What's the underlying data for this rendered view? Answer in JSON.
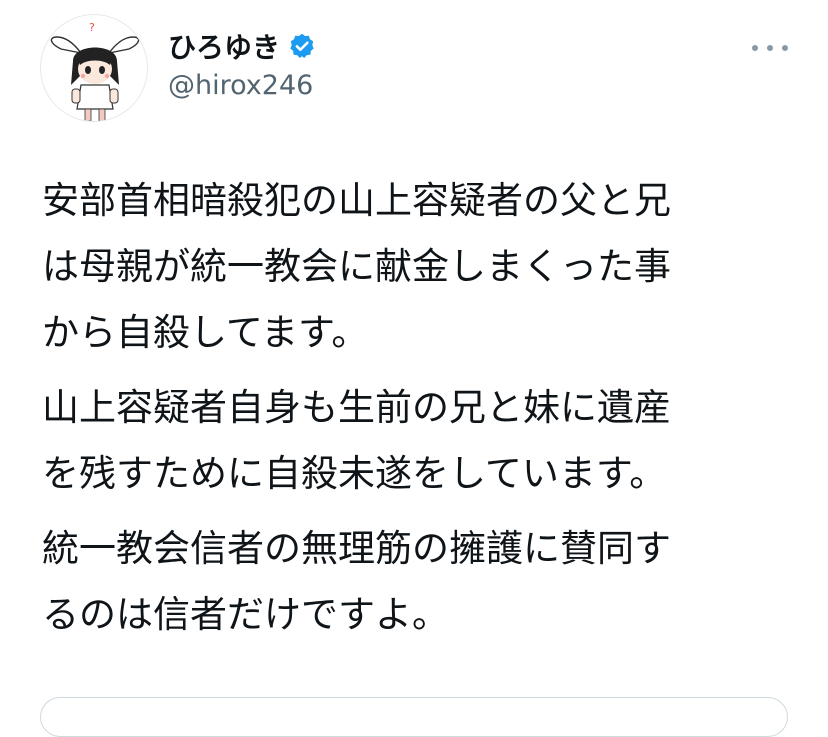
{
  "author": {
    "display_name": "ひろゆき",
    "handle": "@hirox246",
    "verified": true,
    "verified_color": "#1d9bf0",
    "avatar_icon": "rabbit-ear-character-avatar"
  },
  "menu": {
    "icon": "more-horizontal-icon"
  },
  "tweet": {
    "paragraphs": [
      "安部首相暗殺犯の山上容疑者の父と兄\nは母親が統一教会に献金しまくった事\nから自殺してます。",
      "山上容疑者自身も生前の兄と妹に遺産\nを残すために自殺未遂をしています。",
      "統一教会信者の無理筋の擁護に賛同す\nるのは信者だけですよ。"
    ]
  },
  "colors": {
    "text": "#0f1419",
    "secondary_text": "#536471",
    "border": "#cfd9de"
  }
}
